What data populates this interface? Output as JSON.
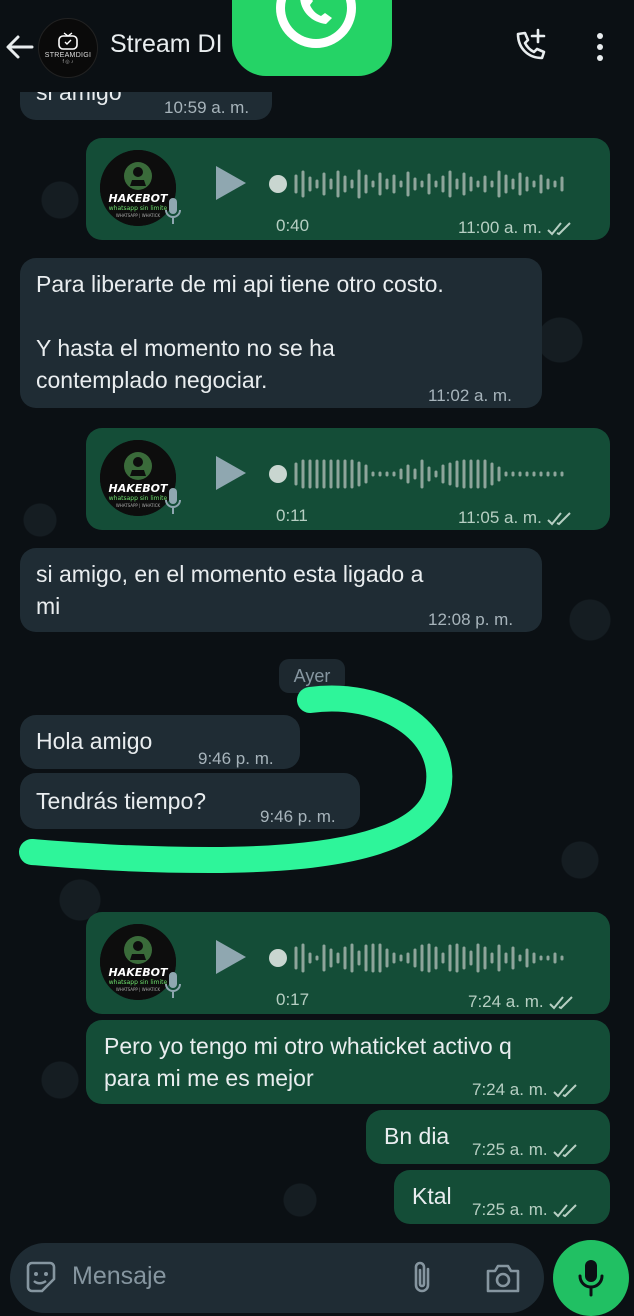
{
  "header": {
    "contact_name": "Stream DI",
    "avatar_brand": "STREAMDIGI",
    "avatar_sub": "f ◎ ♪"
  },
  "messages": [
    {
      "id": "m1",
      "direction": "in",
      "text": "si amigo",
      "time": "10:59 a. m."
    },
    {
      "id": "m2",
      "direction": "out",
      "type": "voice",
      "duration": "0:40",
      "time": "11:00 a. m.",
      "thumb_brand": "HAKEBOT",
      "thumb_sub": "whatsapp sin limite",
      "thumb_tag": "WHATSAPP | WHATICK"
    },
    {
      "id": "m3",
      "direction": "in",
      "lines": [
        "Para liberarte de mi api tiene otro costo.",
        "",
        "Y hasta el momento no se ha",
        "contemplado negociar."
      ],
      "time": "11:02 a. m."
    },
    {
      "id": "m4",
      "direction": "out",
      "type": "voice",
      "duration": "0:11",
      "time": "11:05 a. m.",
      "thumb_brand": "HAKEBOT",
      "thumb_sub": "whatsapp sin limite",
      "thumb_tag": "WHATSAPP | WHATICK"
    },
    {
      "id": "m5",
      "direction": "in",
      "lines": [
        "si amigo, en el momento esta ligado a",
        "mi"
      ],
      "time": "12:08 p. m."
    },
    {
      "id": "m6",
      "direction": "in",
      "text": "Hola amigo",
      "time": "9:46 p. m."
    },
    {
      "id": "m7",
      "direction": "in",
      "text": "Tendrás tiempo?",
      "time": "9:46 p. m."
    },
    {
      "id": "m8",
      "direction": "out",
      "type": "voice",
      "duration": "0:17",
      "time": "7:24 a. m.",
      "thumb_brand": "HAKEBOT",
      "thumb_sub": "whatsapp sin limite",
      "thumb_tag": "WHATSAPP | WHATICK"
    },
    {
      "id": "m9",
      "direction": "out",
      "lines": [
        "Pero yo tengo mi otro whaticket activo q",
        "para mi me es mejor"
      ],
      "time": "7:24 a. m."
    },
    {
      "id": "m10",
      "direction": "out",
      "text": "Bn dia",
      "time": "7:25 a. m."
    },
    {
      "id": "m11",
      "direction": "out",
      "text": "Ktal",
      "time": "7:25 a. m."
    }
  ],
  "date_separator": "Ayer",
  "composer": {
    "placeholder": "Mensaje"
  },
  "colors": {
    "background": "#0b1014",
    "incoming_bubble": "#1f2c34",
    "outgoing_bubble": "#144d37",
    "accent": "#21c063",
    "highlight_stroke": "#2ef59a"
  }
}
